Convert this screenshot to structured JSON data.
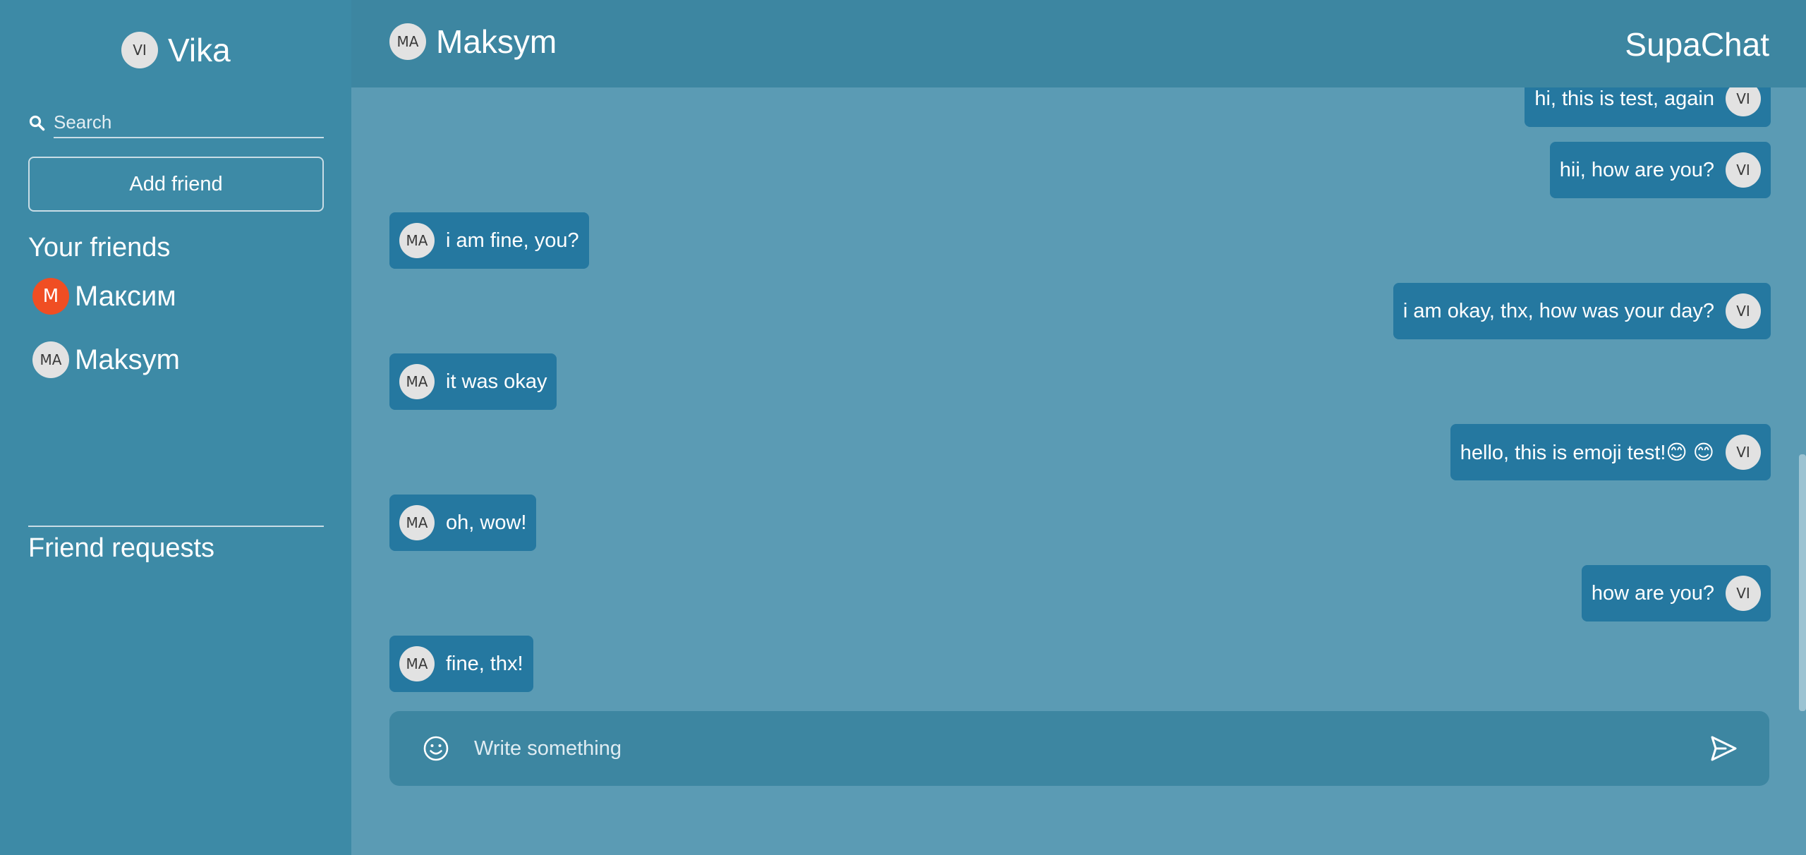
{
  "app": {
    "brand": "SupaChat"
  },
  "current_user": {
    "initials": "VI",
    "name": "Vika"
  },
  "sidebar": {
    "search_placeholder": "Search",
    "add_friend_label": "Add friend",
    "friends_title": "Your friends",
    "friends": [
      {
        "initials": "M",
        "name": "Максим"
      },
      {
        "initials": "MA",
        "name": "Maksym"
      }
    ],
    "requests_title": "Friend requests"
  },
  "chat": {
    "partner": {
      "initials": "MA",
      "name": "Maksym"
    },
    "messages": [
      {
        "side": "right",
        "initials": "VI",
        "text": "hi, this is test, again"
      },
      {
        "side": "right",
        "initials": "VI",
        "text": "hii, how are you?"
      },
      {
        "side": "left",
        "initials": "MA",
        "text": "i am fine, you?"
      },
      {
        "side": "right",
        "initials": "VI",
        "text": "i am okay, thx, how was your day?"
      },
      {
        "side": "left",
        "initials": "MA",
        "text": "it was okay"
      },
      {
        "side": "right",
        "initials": "VI",
        "text": "hello, this is emoji test!😊 😊"
      },
      {
        "side": "left",
        "initials": "MA",
        "text": "oh, wow!"
      },
      {
        "side": "right",
        "initials": "VI",
        "text": "how are you?"
      },
      {
        "side": "left",
        "initials": "MA",
        "text": "fine, thx!"
      }
    ]
  },
  "composer": {
    "placeholder": "Write something",
    "emoji_icon": "smiley-icon",
    "send_icon": "send-icon"
  },
  "colors": {
    "sidebar_bg": "#3d8aa6",
    "header_bg": "#3d86a1",
    "chat_bg": "#5b9bb4",
    "bubble_bg": "#2578a0",
    "avatar_bg": "#e2e2e2",
    "friend_avatar_accent": "#f04e23"
  }
}
